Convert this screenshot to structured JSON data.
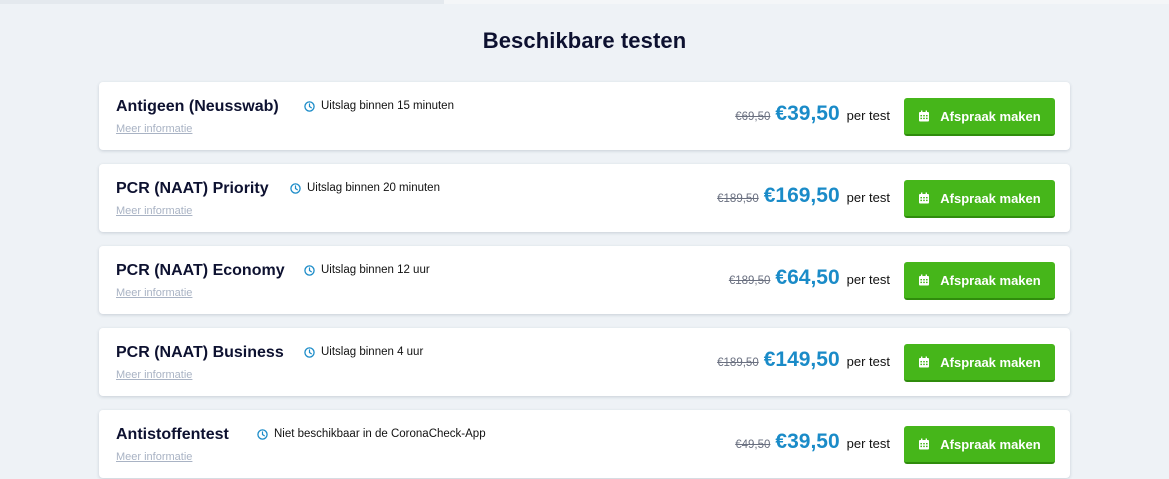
{
  "page": {
    "title": "Beschikbare testen"
  },
  "colors": {
    "accent": "#1a8bc8",
    "button": "#46b61a",
    "link": "#a9b3c4",
    "background": "#eef2f6"
  },
  "icons": {
    "result": "clock-icon",
    "button": "calendar-icon"
  },
  "tests": [
    {
      "name": "Antigeen (Neusswab)",
      "result": "Uitslag binnen 15 minuten",
      "more": "Meer informatie",
      "old_price": "€69,50",
      "price": "€39,50",
      "unit": "per test",
      "button": "Afspraak maken"
    },
    {
      "name": "PCR (NAAT) Priority",
      "result": "Uitslag binnen 20 minuten",
      "more": "Meer informatie",
      "old_price": "€189,50",
      "price": "€169,50",
      "unit": "per test",
      "button": "Afspraak maken"
    },
    {
      "name": "PCR (NAAT) Economy",
      "result": "Uitslag binnen 12 uur",
      "more": "Meer informatie",
      "old_price": "€189,50",
      "price": "€64,50",
      "unit": "per test",
      "button": "Afspraak maken"
    },
    {
      "name": "PCR (NAAT) Business",
      "result": "Uitslag binnen 4 uur",
      "more": "Meer informatie",
      "old_price": "€189,50",
      "price": "€149,50",
      "unit": "per test",
      "button": "Afspraak maken"
    },
    {
      "name": "Antistoffentest",
      "result": "Niet beschikbaar in de CoronaCheck-App",
      "more": "Meer informatie",
      "old_price": "€49,50",
      "price": "€39,50",
      "unit": "per test",
      "button": "Afspraak maken"
    }
  ]
}
